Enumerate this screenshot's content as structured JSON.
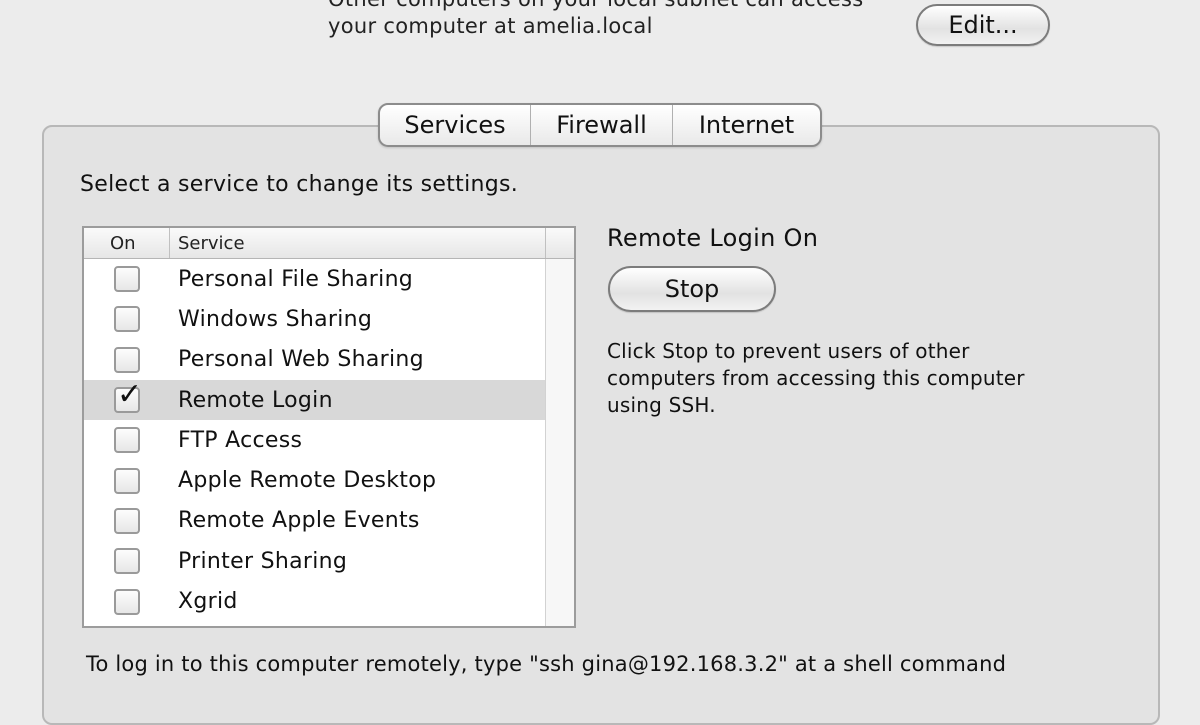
{
  "network": {
    "line1": "Other computers on your local subnet can access",
    "line2": "your computer at amelia.local",
    "edit_label": "Edit..."
  },
  "tabs": [
    {
      "label": "Services",
      "active": true
    },
    {
      "label": "Firewall",
      "active": false
    },
    {
      "label": "Internet",
      "active": false
    }
  ],
  "instruction": "Select a service to change its settings.",
  "service_list": {
    "header_on": "On",
    "header_service": "Service",
    "rows": [
      {
        "label": "Personal File Sharing",
        "checked": false
      },
      {
        "label": "Windows Sharing",
        "checked": false
      },
      {
        "label": "Personal Web Sharing",
        "checked": false
      },
      {
        "label": "Remote Login",
        "checked": true,
        "selected": true
      },
      {
        "label": "FTP Access",
        "checked": false
      },
      {
        "label": "Apple Remote Desktop",
        "checked": false
      },
      {
        "label": "Remote Apple Events",
        "checked": false
      },
      {
        "label": "Printer Sharing",
        "checked": false
      },
      {
        "label": "Xgrid",
        "checked": false
      }
    ]
  },
  "detail": {
    "status": "Remote Login On",
    "stop_label": "Stop",
    "help_line1": "Click Stop to prevent users of other",
    "help_line2": "computers from accessing this computer",
    "help_line3": "using SSH."
  },
  "footer": "To log in to this computer remotely, type \"ssh gina@192.168.3.2\" at a shell command"
}
